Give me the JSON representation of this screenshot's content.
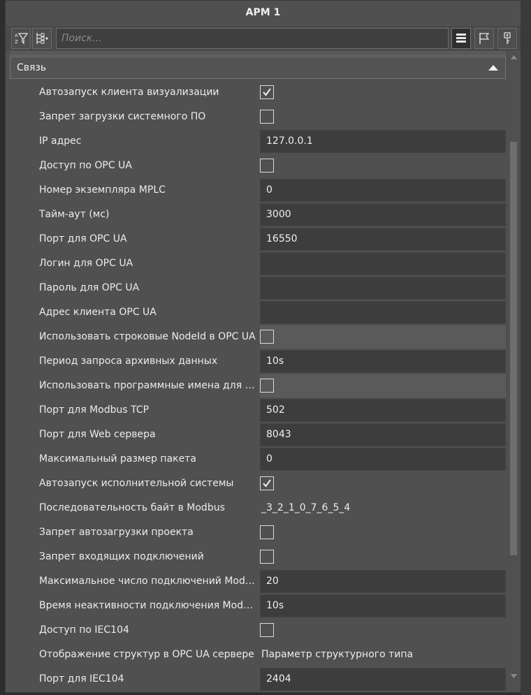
{
  "window": {
    "title": "АРМ 1"
  },
  "toolbar": {
    "search_placeholder": "Поиск...",
    "left_icons": [
      "sort-az-filter-icon",
      "expand-collapse-tree-icon"
    ],
    "right_icons": [
      "list-view-icon",
      "flag-icon",
      "key-icon"
    ]
  },
  "section": {
    "title": "Связь",
    "expanded": true
  },
  "rows": [
    {
      "label": "Автозапуск клиента визуализации",
      "type": "checkbox",
      "checked": true
    },
    {
      "label": "Запрет загрузки системного ПО",
      "type": "checkbox",
      "checked": false
    },
    {
      "label": "IP адрес",
      "type": "field",
      "value": "127.0.0.1"
    },
    {
      "label": "Доступ по OPC UA",
      "type": "checkbox",
      "checked": false
    },
    {
      "label": "Номер экземпляра MPLC",
      "type": "field",
      "value": "0"
    },
    {
      "label": "Тайм-аут (мс)",
      "type": "field",
      "value": "3000"
    },
    {
      "label": "Порт для OPC UA",
      "type": "field",
      "value": "16550"
    },
    {
      "label": "Логин для OPC UA",
      "type": "field",
      "value": ""
    },
    {
      "label": "Пароль для OPC UA",
      "type": "field",
      "value": ""
    },
    {
      "label": "Адрес клиента OPC UA",
      "type": "field",
      "value": ""
    },
    {
      "label": "Использовать строковые NodeId в OPC UA",
      "type": "checkbox",
      "checked": false,
      "highlight": true
    },
    {
      "label": "Период запроса архивных данных",
      "type": "field",
      "value": "10s"
    },
    {
      "label": "Использовать программные имена для ие...",
      "type": "checkbox",
      "checked": false,
      "highlight": true
    },
    {
      "label": "Порт для Modbus TCP",
      "type": "field",
      "value": "502"
    },
    {
      "label": "Порт для Web сервера",
      "type": "field",
      "value": "8043"
    },
    {
      "label": "Максимальный размер пакета",
      "type": "field",
      "value": "0"
    },
    {
      "label": "Автозапуск исполнительной системы",
      "type": "checkbox",
      "checked": true
    },
    {
      "label": "Последовательность байт в Modbus",
      "type": "text",
      "value": "_3_2_1_0_7_6_5_4"
    },
    {
      "label": "Запрет автозагрузки проекта",
      "type": "checkbox",
      "checked": false
    },
    {
      "label": "Запрет входящих подключений",
      "type": "checkbox",
      "checked": false
    },
    {
      "label": "Максимальное число подключений Modbu...",
      "type": "field",
      "value": "20"
    },
    {
      "label": "Время неактивности подключения Modbus...",
      "type": "field",
      "value": "10s"
    },
    {
      "label": "Доступ по IEC104",
      "type": "checkbox",
      "checked": false
    },
    {
      "label": "Отображение структур в OPC UA сервере",
      "type": "text",
      "value": "Параметр структурного типа"
    },
    {
      "label": "Порт для IEC104",
      "type": "field",
      "value": "2404"
    }
  ]
}
